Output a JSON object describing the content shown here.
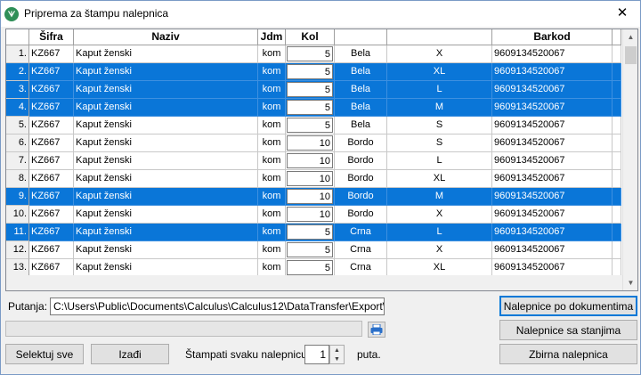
{
  "window": {
    "title": "Priprema za štampu nalepnica",
    "app_icon_text": "ᗐ"
  },
  "grid": {
    "headers": {
      "rownum": "",
      "sifra": "Šifra",
      "naziv": "Naziv",
      "jdm": "Jdm",
      "kol": "Kol",
      "boja": "",
      "velicina": "",
      "barkod": "Barkod"
    },
    "rows": [
      {
        "num": "1.",
        "sifra": "KZ667",
        "naziv": "Kaput ženski",
        "jdm": "kom",
        "kol": "5",
        "boja": "Bela",
        "velicina": "X",
        "barkod": "9609134520067",
        "selected": false
      },
      {
        "num": "2.",
        "sifra": "KZ667",
        "naziv": "Kaput ženski",
        "jdm": "kom",
        "kol": "5",
        "boja": "Bela",
        "velicina": "XL",
        "barkod": "9609134520067",
        "selected": true
      },
      {
        "num": "3.",
        "sifra": "KZ667",
        "naziv": "Kaput ženski",
        "jdm": "kom",
        "kol": "5",
        "boja": "Bela",
        "velicina": "L",
        "barkod": "9609134520067",
        "selected": true
      },
      {
        "num": "4.",
        "sifra": "KZ667",
        "naziv": "Kaput ženski",
        "jdm": "kom",
        "kol": "5",
        "boja": "Bela",
        "velicina": "M",
        "barkod": "9609134520067",
        "selected": true
      },
      {
        "num": "5.",
        "sifra": "KZ667",
        "naziv": "Kaput ženski",
        "jdm": "kom",
        "kol": "5",
        "boja": "Bela",
        "velicina": "S",
        "barkod": "9609134520067",
        "selected": false
      },
      {
        "num": "6.",
        "sifra": "KZ667",
        "naziv": "Kaput ženski",
        "jdm": "kom",
        "kol": "10",
        "boja": "Bordo",
        "velicina": "S",
        "barkod": "9609134520067",
        "selected": false
      },
      {
        "num": "7.",
        "sifra": "KZ667",
        "naziv": "Kaput ženski",
        "jdm": "kom",
        "kol": "10",
        "boja": "Bordo",
        "velicina": "L",
        "barkod": "9609134520067",
        "selected": false
      },
      {
        "num": "8.",
        "sifra": "KZ667",
        "naziv": "Kaput ženski",
        "jdm": "kom",
        "kol": "10",
        "boja": "Bordo",
        "velicina": "XL",
        "barkod": "9609134520067",
        "selected": false
      },
      {
        "num": "9.",
        "sifra": "KZ667",
        "naziv": "Kaput ženski",
        "jdm": "kom",
        "kol": "10",
        "boja": "Bordo",
        "velicina": "M",
        "barkod": "9609134520067",
        "selected": true
      },
      {
        "num": "10.",
        "sifra": "KZ667",
        "naziv": "Kaput ženski",
        "jdm": "kom",
        "kol": "10",
        "boja": "Bordo",
        "velicina": "X",
        "barkod": "9609134520067",
        "selected": false
      },
      {
        "num": "11.",
        "sifra": "KZ667",
        "naziv": "Kaput ženski",
        "jdm": "kom",
        "kol": "5",
        "boja": "Crna",
        "velicina": "L",
        "barkod": "9609134520067",
        "selected": true
      },
      {
        "num": "12.",
        "sifra": "KZ667",
        "naziv": "Kaput ženski",
        "jdm": "kom",
        "kol": "5",
        "boja": "Crna",
        "velicina": "X",
        "barkod": "9609134520067",
        "selected": false
      },
      {
        "num": "13.",
        "sifra": "KZ667",
        "naziv": "Kaput ženski",
        "jdm": "kom",
        "kol": "5",
        "boja": "Crna",
        "velicina": "XL",
        "barkod": "9609134520067",
        "selected": false
      }
    ]
  },
  "path": {
    "label": "Putanja:",
    "value": "C:\\Users\\Public\\Documents\\Calculus\\Calculus12\\DataTransfer\\Export\\"
  },
  "buttons": {
    "select_all": "Selektuj sve",
    "exit": "Izađi",
    "labels_by_document": "Nalepnice po dokumentima",
    "labels_with_stock": "Nalepnice sa stanjima",
    "summary_label": "Zbirna nalepnica"
  },
  "print_each": {
    "label": "Štampati svaku nalepnicu",
    "value": "1",
    "suffix": "puta."
  },
  "colors": {
    "selection": "#0a76d8",
    "default_button_border": "#0078d7"
  },
  "icons": {
    "close": "close-icon",
    "print": "printer-icon",
    "spin_up": "arrow-up-icon",
    "spin_down": "arrow-down-icon"
  }
}
